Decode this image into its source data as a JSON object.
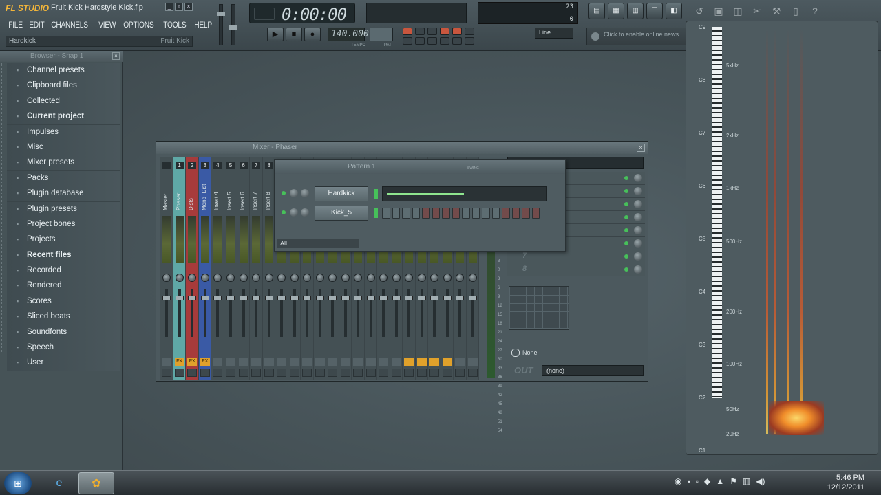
{
  "app": {
    "logo": "FL STUDIO",
    "project_title": "Fruit Kick Hardstyle Kick.flp"
  },
  "menu": [
    "FILE",
    "EDIT",
    "CHANNELS",
    "VIEW",
    "OPTIONS",
    "TOOLS",
    "HELP"
  ],
  "hint_bar": {
    "left": "Hardkick",
    "right": "Fruit Kick"
  },
  "transport": {
    "time": "0:00:00",
    "tempo": "140.000",
    "tempo_label": "TEMPO",
    "pattern_label": "PAT",
    "snap": "Line",
    "cpu_value": "23",
    "poly_value": "0"
  },
  "news": "Click to enable online news",
  "browser": {
    "title": "Browser - Snap 1",
    "items": [
      {
        "label": "Channel presets",
        "bold": false
      },
      {
        "label": "Clipboard files",
        "bold": false
      },
      {
        "label": "Collected",
        "bold": false
      },
      {
        "label": "Current project",
        "bold": true
      },
      {
        "label": "Impulses",
        "bold": false
      },
      {
        "label": "Misc",
        "bold": false
      },
      {
        "label": "Mixer presets",
        "bold": false
      },
      {
        "label": "Packs",
        "bold": false
      },
      {
        "label": "Plugin database",
        "bold": false
      },
      {
        "label": "Plugin presets",
        "bold": false
      },
      {
        "label": "Project bones",
        "bold": false
      },
      {
        "label": "Projects",
        "bold": false
      },
      {
        "label": "Recent files",
        "bold": true
      },
      {
        "label": "Recorded",
        "bold": false
      },
      {
        "label": "Rendered",
        "bold": false
      },
      {
        "label": "Scores",
        "bold": false
      },
      {
        "label": "Sliced beats",
        "bold": false
      },
      {
        "label": "Soundfonts",
        "bold": false
      },
      {
        "label": "Speech",
        "bold": false
      },
      {
        "label": "User",
        "bold": false
      }
    ]
  },
  "mixer": {
    "title": "Mixer - Phaser",
    "tracks": [
      {
        "num": "",
        "name": "Master",
        "style": "normal",
        "fx": ""
      },
      {
        "num": "1",
        "name": "Phaser",
        "style": "sel",
        "fx": "FX"
      },
      {
        "num": "2",
        "name": "Dists",
        "style": "red",
        "fx": "FX"
      },
      {
        "num": "3",
        "name": "Mono+Dist",
        "style": "blue",
        "fx": "FX"
      },
      {
        "num": "4",
        "name": "Insert 4",
        "style": "normal",
        "fx": ""
      },
      {
        "num": "5",
        "name": "Insert 5",
        "style": "normal",
        "fx": ""
      },
      {
        "num": "6",
        "name": "Insert 6",
        "style": "normal",
        "fx": ""
      },
      {
        "num": "7",
        "name": "Insert 7",
        "style": "normal",
        "fx": ""
      },
      {
        "num": "8",
        "name": "Insert 8",
        "style": "normal",
        "fx": ""
      }
    ],
    "slots": [
      "",
      "",
      "",
      "",
      "",
      "",
      "7",
      "8"
    ],
    "routing_none": "None",
    "out_label": "OUT",
    "out_value": "(none)",
    "db_scale": [
      "3",
      "0",
      "3",
      "6",
      "9",
      "12",
      "15",
      "18",
      "21",
      "24",
      "27",
      "30",
      "33",
      "36",
      "39",
      "42",
      "45",
      "48",
      "51",
      "54"
    ]
  },
  "pattern_window": {
    "title": "Pattern 1",
    "swing_label": "SWING",
    "channels": [
      {
        "name": "Hardkick",
        "mode": "graph"
      },
      {
        "name": "Kick_5",
        "mode": "steps"
      }
    ],
    "filter": "All"
  },
  "spectrogram": {
    "octaves": [
      "C9",
      "C8",
      "C7",
      "C6",
      "C5",
      "C4",
      "C3",
      "C2",
      "C1"
    ],
    "freqs": [
      "5kHz",
      "2kHz",
      "1kHz",
      "500Hz",
      "200Hz",
      "100Hz",
      "50Hz",
      "20Hz"
    ]
  },
  "taskbar": {
    "time": "5:46 PM",
    "date": "12/12/2011"
  }
}
